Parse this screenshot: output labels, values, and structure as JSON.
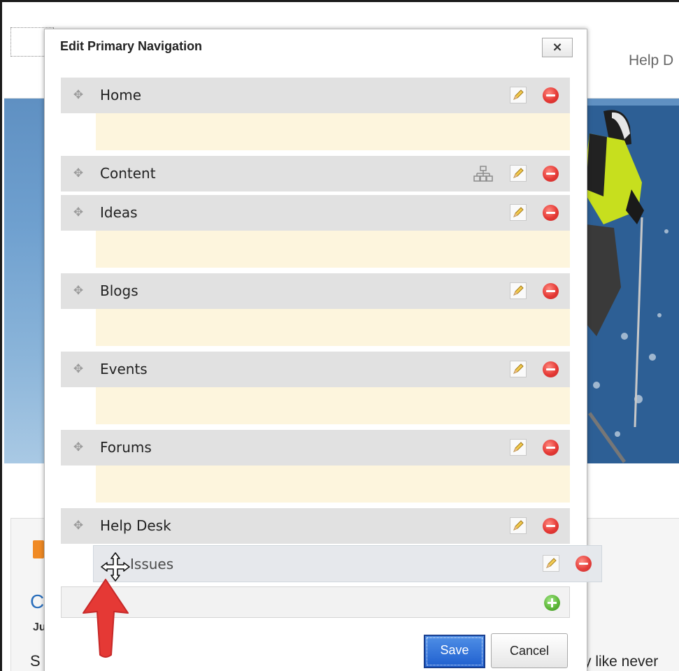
{
  "background_page": {
    "nav_item": "Help D",
    "card_letters": {
      "heading": "C",
      "date": "Ju",
      "text": "S"
    },
    "text_fragment": "y like never"
  },
  "dialog": {
    "title": "Edit Primary Navigation",
    "close_icon": "×",
    "items": [
      {
        "label": "Home"
      },
      {
        "label": "Content"
      },
      {
        "label": "Ideas"
      },
      {
        "label": "Blogs"
      },
      {
        "label": "Events"
      },
      {
        "label": "Forums"
      },
      {
        "label": "Help Desk"
      }
    ],
    "dragged_item": {
      "label": "Issues"
    },
    "save_label": "Save",
    "cancel_label": "Cancel",
    "colors": {
      "row": "#e1e1e1",
      "drop_zone": "#fdf5dd",
      "save_button": "#2a64d6",
      "remove_icon": "#e53935",
      "add_icon": "#5fb83a",
      "annotation_arrow": "#e53935"
    },
    "icons": [
      "move-handle-icon",
      "hierarchy-icon",
      "pencil-edit-icon",
      "remove-minus-icon",
      "add-plus-icon",
      "move-cursor-icon",
      "annotation-arrow"
    ]
  }
}
